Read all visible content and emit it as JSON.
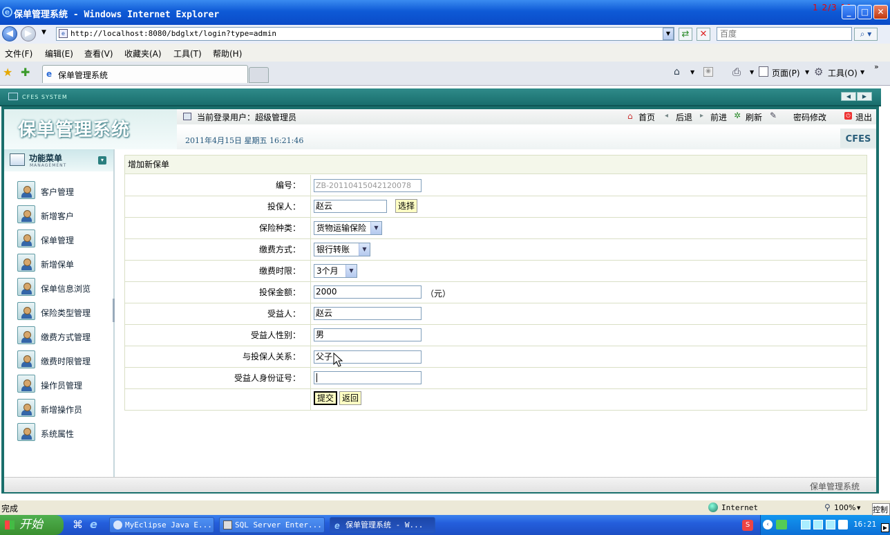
{
  "window": {
    "title": "保单管理系统 - Windows Internet Explorer",
    "corner_text": "1 2/3 11"
  },
  "browser": {
    "url": "http://localhost:8080/bdglxt/login?type=admin",
    "search_placeholder": "百度",
    "menu": [
      "文件(F)",
      "编辑(E)",
      "查看(V)",
      "收藏夹(A)",
      "工具(T)",
      "帮助(H)"
    ],
    "tab_title": "保单管理系统",
    "toolbar": {
      "page": "页面(P)",
      "tools": "工具(O)"
    },
    "status_left": "完成",
    "zone": "Internet",
    "zoom": "100%"
  },
  "app": {
    "system_label": "CFES SYSTEM",
    "logo": "保单管理系统",
    "user_label": "当前登录用户：超级管理员",
    "datetime": "2011年4月15日  星期五   16:21:46",
    "brand": "CFES",
    "nav": [
      "首页",
      "后退",
      "前进",
      "刷新",
      "密码修改",
      "退出"
    ],
    "footer": "保单管理系统"
  },
  "sidebar": {
    "title": "功能菜单",
    "subtitle": "MANAGEMENT",
    "items": [
      "客户管理",
      "新增客户",
      "保单管理",
      "新增保单",
      "保单信息浏览",
      "保险类型管理",
      "缴费方式管理",
      "缴费时限管理",
      "操作员管理",
      "新增操作员",
      "系统属性"
    ]
  },
  "form": {
    "title": "增加新保单",
    "labels": {
      "id": "编号：",
      "insured": "投保人：",
      "type": "保险种类：",
      "payment": "缴费方式：",
      "term": "缴费时限：",
      "amount": "投保金额：",
      "beneficiary": "受益人：",
      "gender": "受益人性别：",
      "relation": "与投保人关系：",
      "idcard": "受益人身份证号："
    },
    "values": {
      "id": "ZB-20110415042120078",
      "insured": "赵云",
      "type": "货物运输保险",
      "payment": "银行转账",
      "term": "3个月",
      "amount": "2000",
      "beneficiary": "赵云",
      "gender": "男",
      "relation": "父子",
      "idcard": ""
    },
    "choose_button": "选择",
    "unit": "（元）",
    "submit": "提交",
    "back": "返回"
  },
  "taskbar": {
    "start": "开始",
    "tasks": [
      "MyEclipse Java E...",
      "SQL Server Enter...",
      "保单管理系统 - W..."
    ],
    "time": "16:21",
    "side_label": "控制"
  }
}
